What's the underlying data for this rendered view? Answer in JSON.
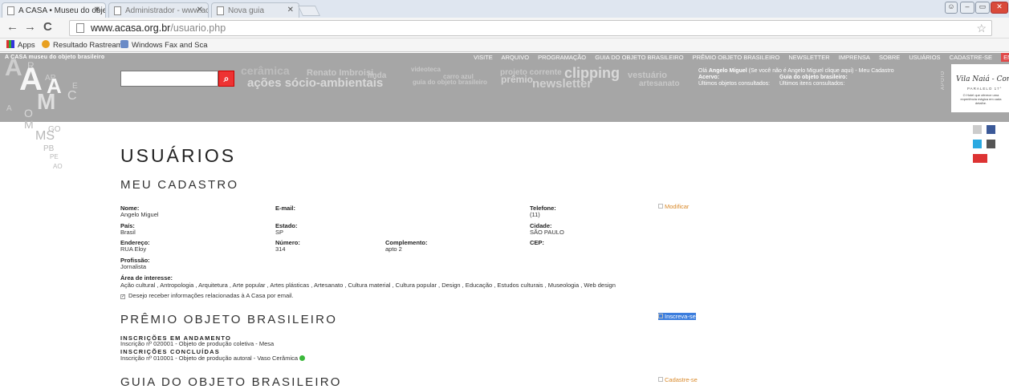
{
  "browser": {
    "tabs": [
      {
        "label": "A CASA • Museu do obje"
      },
      {
        "label": "Administrador - www.aca"
      },
      {
        "label": "Nova guia"
      }
    ],
    "url_domain": "www.acasa.org.br",
    "url_path": "/usuario.php",
    "bookmarks": [
      "Apps",
      "Resultado Rastreame",
      "Windows Fax and Sca"
    ]
  },
  "site": {
    "name": "A CASA museu do objeto brasileiro",
    "nav": [
      "VISITE",
      "ARQUIVO",
      "PROGRAMAÇÃO",
      "GUIA DO OBJETO BRASILEIRO",
      "PRÊMIO OBJETO BRASILEIRO",
      "NEWSLETTER",
      "IMPRENSA",
      "SOBRE",
      "USUÁRIOS",
      "CADASTRE-SE",
      "EN"
    ],
    "search_placeholder": "",
    "tag_cloud": [
      "cerâmica",
      "Renato Imbroisi",
      "linda",
      "ações sócio-ambientais",
      "videoteca",
      "carro azul",
      "guia do objeto brasileiro",
      "projeto corrente",
      "prêmio",
      "newsletter",
      "clipping",
      "vestuário",
      "artesanato"
    ],
    "user": {
      "greeting_prefix": "Olá",
      "name": "Angelo Miguel",
      "greeting_suffix": "(Se você não é Angelo Miguel clique aqui) - Meu Cadastro",
      "acervo_label": "Acervo:",
      "acervo_sub": "Últimos objetos consultados:",
      "guia_label": "Guia do objeto brasileiro:",
      "guia_sub": "Últimos itens consultados:"
    },
    "apoio": "APOIO",
    "sponsor": {
      "title": "Vila Naiá - Corumbau",
      "subtitle": "PARALELO 17°",
      "desc": "O Hotel que oferece uma experiência mágica em cada detalhe."
    }
  },
  "page": {
    "title": "USUÁRIOS",
    "meu_cadastro": {
      "title": "MEU CADASTRO",
      "modify": "Modificar",
      "fields": {
        "nome_label": "Nome:",
        "nome": "Angelo Miguel",
        "email_label": "E-mail:",
        "email": "",
        "telefone_label": "Telefone:",
        "telefone": "(11)",
        "pais_label": "País:",
        "pais": "Brasil",
        "estado_label": "Estado:",
        "estado": "SP",
        "cidade_label": "Cidade:",
        "cidade": "SÃO PAULO",
        "endereco_label": "Endereço:",
        "endereco": "RUA Eloy",
        "numero_label": "Número:",
        "numero": "314",
        "complemento_label": "Complemento:",
        "complemento": "apto 2",
        "cep_label": "CEP:",
        "cep": "",
        "profissao_label": "Profissão:",
        "profissao": "Jornalista",
        "area_label": "Área de interesse:",
        "area": "Ação cultural , Antropologia , Arquitetura , Arte popular , Artes plásticas , Artesanato , Cultura material , Cultura popular , Design , Educação , Estudos culturais , Museologia , Web design"
      },
      "newsletter_opt": "Desejo receber informações relacionadas à A Casa por email.",
      "newsletter_checked": true
    },
    "premio": {
      "title": "PRÊMIO OBJETO BRASILEIRO",
      "action": "Inscreva-se",
      "andamento_label": "INSCRIÇÕES EM ANDAMENTO",
      "andamento_item": "Inscrição nº 020001 - Objeto de produção coletiva - Mesa",
      "concluidas_label": "INSCRIÇÕES CONCLUÍDAS",
      "concluidas_item": "Inscrição nº 010001 - Objeto de produção autoral - Vaso Cerâmica"
    },
    "guia": {
      "title": "GUIA DO OBJETO BRASILEIRO",
      "action": "Cadastre-se"
    }
  },
  "colors": {
    "header_gray": "#a6a6a6",
    "accent_orange": "#d9892a",
    "search_red": "#e33333",
    "selection_blue": "#3b7ddd"
  }
}
